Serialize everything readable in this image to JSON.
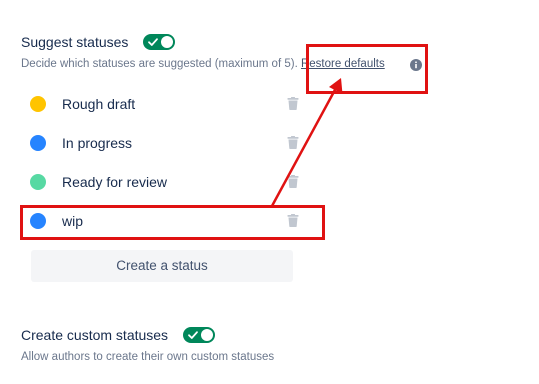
{
  "suggest": {
    "title": "Suggest statuses",
    "toggle_on": true,
    "description": "Decide which statuses are suggested (maximum of 5).",
    "restore_link": "Restore defaults",
    "info_icon": "info-icon"
  },
  "statuses": [
    {
      "label": "Rough draft",
      "color": "#ffc400",
      "icon": "trash-icon"
    },
    {
      "label": "In progress",
      "color": "#2684ff",
      "icon": "trash-icon"
    },
    {
      "label": "Ready for review",
      "color": "#57d9a3",
      "icon": "trash-icon"
    },
    {
      "label": "wip",
      "color": "#2684ff",
      "icon": "trash-icon"
    }
  ],
  "create_button": {
    "label": "Create a status"
  },
  "custom": {
    "title": "Create custom statuses",
    "toggle_on": true,
    "description": "Allow authors to create their own custom statuses"
  },
  "colors": {
    "toggle_on": "#00875a",
    "annotation": "#e01212"
  }
}
